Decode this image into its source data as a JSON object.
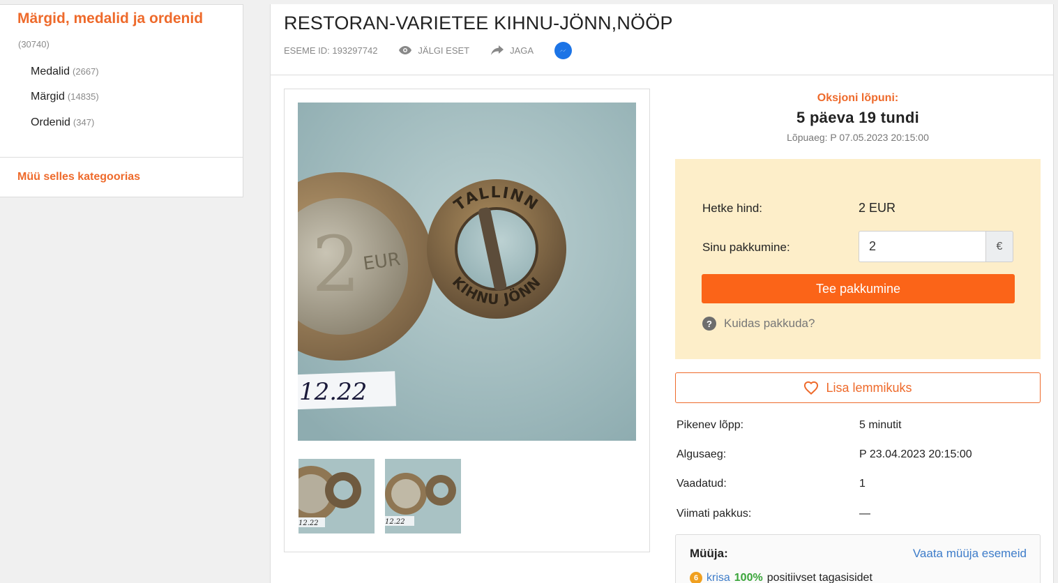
{
  "sidebar": {
    "category_title": "Märgid, medalid ja ordenid",
    "category_count": "(30740)",
    "subcategories": [
      {
        "label": "Medalid",
        "count": "(2667)"
      },
      {
        "label": "Märgid",
        "count": "(14835)"
      },
      {
        "label": "Ordenid",
        "count": "(347)"
      }
    ],
    "sell_link": "Müü selles kategoorias"
  },
  "item": {
    "title": "RESTORAN-VARIETEE KIHNU-JÖNN,NÖÖP",
    "id_label": "ESEME ID: 193297742",
    "follow_label": "JÄLGI ESET",
    "share_label": "JAGA"
  },
  "photo": {
    "main_caption": "12.22",
    "button_text_top": "TALLINN",
    "button_text_bottom": "KIHNU JÖNN",
    "coin_text": "2 EURO"
  },
  "auction": {
    "end_label": "Oksjoni lõpuni:",
    "time_left": "5 päeva 19 tundi",
    "end_date": "Lõpuaeg: P 07.05.2023 20:15:00",
    "current_price_label": "Hetke hind:",
    "current_price": "2 EUR",
    "your_bid_label": "Sinu pakkumine:",
    "your_bid_value": "2",
    "currency_symbol": "€",
    "bid_button": "Tee pakkumine",
    "how_to_bid": "Kuidas pakkuda?",
    "favorite_button": "Lisa lemmikuks"
  },
  "details": [
    {
      "label": "Pikenev lõpp:",
      "value": "5 minutit"
    },
    {
      "label": "Algusaeg:",
      "value": "P 23.04.2023 20:15:00"
    },
    {
      "label": "Vaadatud:",
      "value": "1"
    },
    {
      "label": "Viimati pakkus:",
      "value": "—"
    }
  ],
  "seller": {
    "label": "Müüja:",
    "view_items_link": "Vaata müüja esemeid",
    "badge": "6",
    "name": "krisa",
    "percent": "100%",
    "feedback_text": "positiivset tagasisidet"
  },
  "colors": {
    "accent": "#ee6a2b",
    "bid_button": "#fb6418",
    "bid_box_bg": "#fdeec9",
    "link_blue": "#3d7cc9"
  }
}
